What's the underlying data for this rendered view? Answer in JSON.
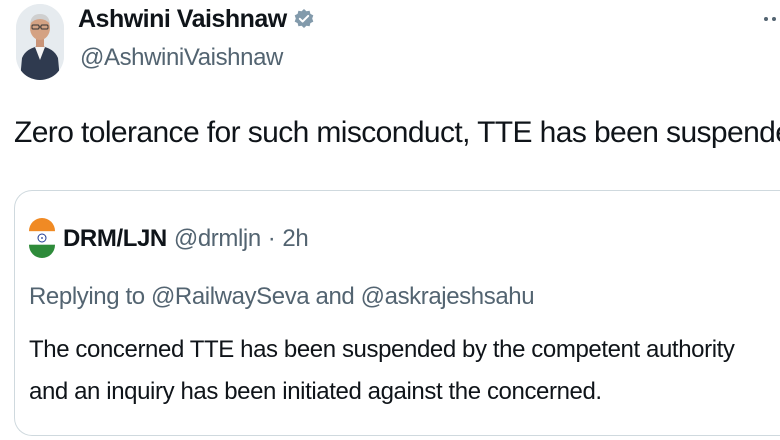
{
  "author": {
    "display_name": "Ashwini Vaishnaw",
    "handle": "@AshwiniVaishnaw",
    "verified": true,
    "avatar_icon": "person-portrait-avatar"
  },
  "tweet": {
    "text": "Zero tolerance for such misconduct, TTE has been suspended."
  },
  "quoted_tweet": {
    "display_name": "DRM/LJN",
    "handle": "@drmljn",
    "separator": "·",
    "time": "2h",
    "avatar_icon": "indian-flag-avatar",
    "replying_prefix": "Replying to",
    "reply_mention_1": "@RailwaySeva",
    "reply_conjunction": "and",
    "reply_mention_2": "@askrajeshsahu",
    "text": "The concerned TTE has been suspended by the competent authority and an inquiry has been initiated against the concerned."
  },
  "colors": {
    "text_primary": "#0f1419",
    "text_secondary": "#536471",
    "verified_badge": "#829aab",
    "border": "#cfd9de",
    "flag_saffron": "#f08a24",
    "flag_green": "#2e8b3a",
    "flag_chakra": "#1f3a93"
  }
}
